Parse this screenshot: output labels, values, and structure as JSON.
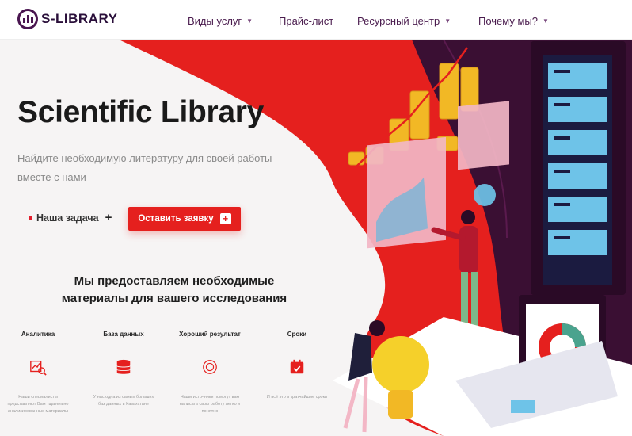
{
  "brand": {
    "name": "S-LIBRARY"
  },
  "nav": [
    {
      "label": "Виды услуг",
      "dropdown": true
    },
    {
      "label": "Прайс-лист",
      "dropdown": false
    },
    {
      "label": "Ресурсный центр",
      "dropdown": true
    },
    {
      "label": "Почему мы?",
      "dropdown": true
    }
  ],
  "hero": {
    "title": "Scientific Library",
    "subtitle": "Найдите необходимую литературу для своей работы вместе с нами",
    "task_label": "Наша задача",
    "cta_label": "Оставить заявку"
  },
  "section": {
    "title": "Мы предоставляем необходимые материалы для вашего исследования"
  },
  "features": [
    {
      "title": "Аналитика",
      "icon": "analytics-icon",
      "text": "Наши специалисты представляют Вам тщательно анализированные материалы"
    },
    {
      "title": "База данных",
      "icon": "database-icon",
      "text": "У нас одна из самых больших баз данных в Казахстане"
    },
    {
      "title": "Хороший результат",
      "icon": "result-icon",
      "text": "Наши источники помогут вам написать свою работу легко и понятно"
    },
    {
      "title": "Сроки",
      "icon": "calendar-icon",
      "text": "И всё это в кратчайшие сроки"
    }
  ],
  "colors": {
    "accent": "#e5201e",
    "brand": "#4a1650",
    "dark_bg": "#3a0f33"
  }
}
